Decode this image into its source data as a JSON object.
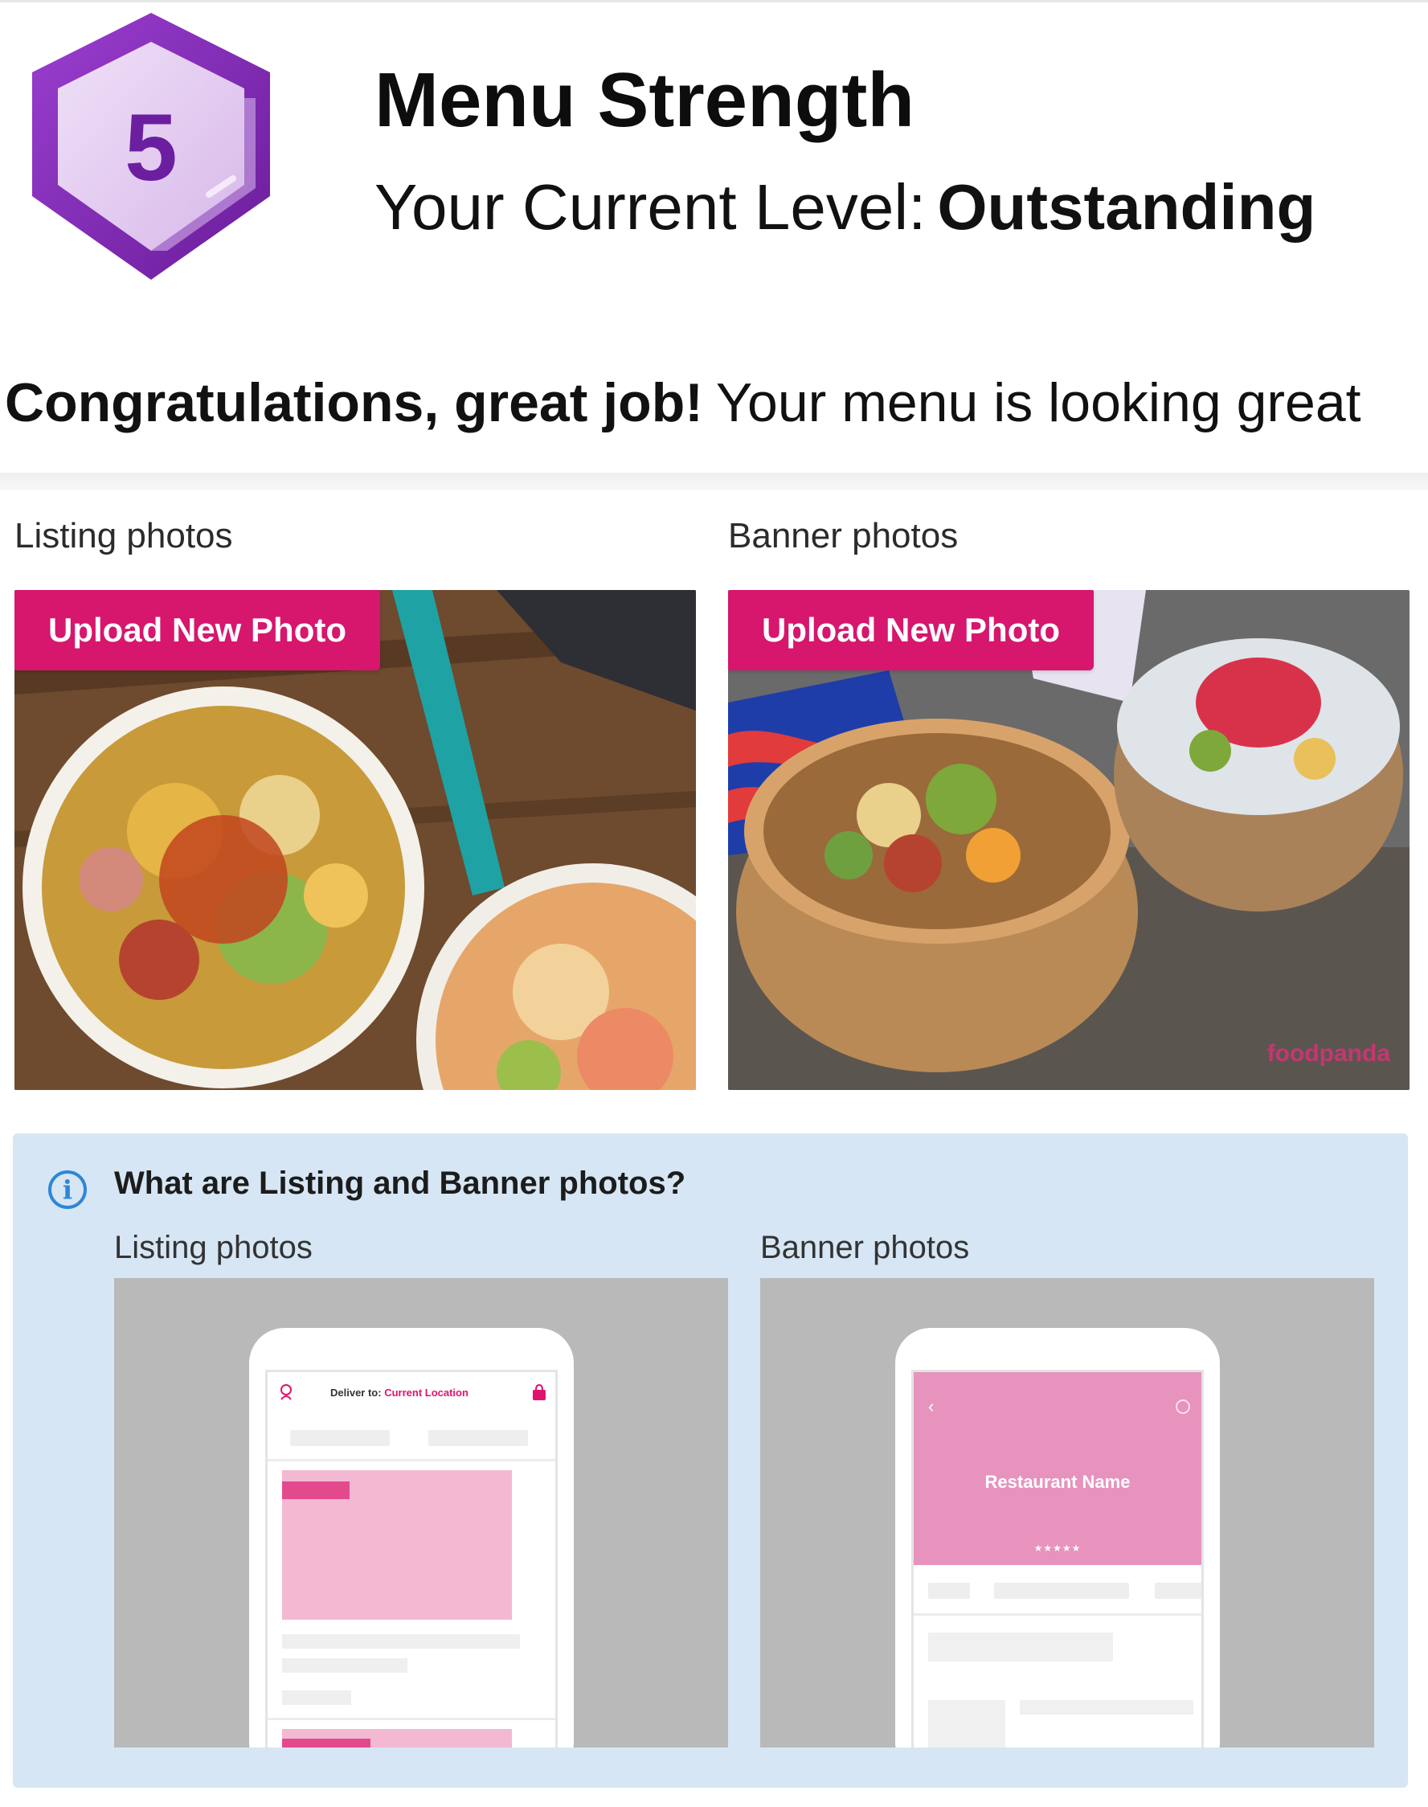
{
  "header": {
    "level_number": "5",
    "title": "Menu Strength",
    "level_label": "Your Current Level:",
    "level_value": "Outstanding"
  },
  "message": {
    "strong": "Congratulations, great job!",
    "rest": "Your menu is looking great"
  },
  "photos": {
    "listing_label": "Listing photos",
    "banner_label": "Banner photos",
    "upload_button": "Upload New Photo",
    "watermark": "foodpanda"
  },
  "info": {
    "title": "What are Listing and Banner photos?",
    "listing_label": "Listing photos",
    "banner_label": "Banner photos",
    "mock_listing": {
      "deliver_to": "Deliver to:",
      "location": "Current Location"
    },
    "mock_banner": {
      "restaurant_name": "Restaurant Name",
      "stars": "★★★★★"
    }
  },
  "colors": {
    "brand_pink": "#d7166e",
    "badge_purple": "#7d2bb0",
    "info_bg": "#d6e6f4",
    "info_icon": "#2f86d6"
  }
}
